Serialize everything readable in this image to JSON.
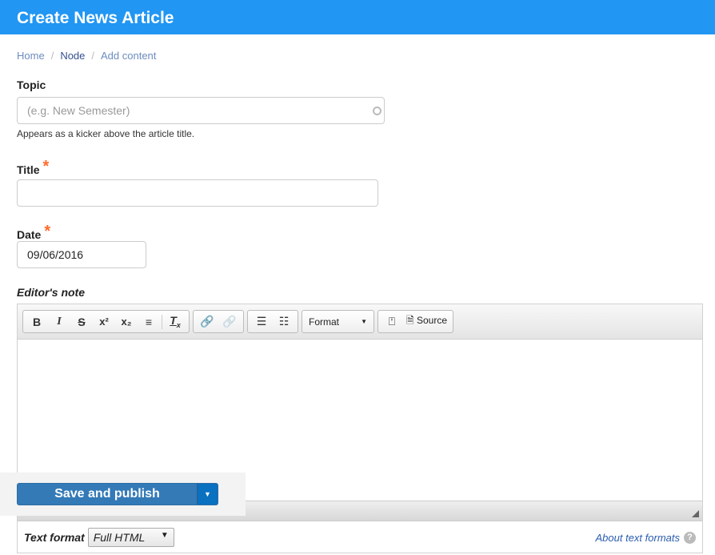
{
  "header": {
    "title": "Create News Article"
  },
  "breadcrumb": [
    "Home",
    "Node",
    "Add content"
  ],
  "fields": {
    "topic": {
      "label": "Topic",
      "placeholder": "(e.g. New Semester)",
      "help": "Appears as a kicker above the article title."
    },
    "title": {
      "label": "Title",
      "required": "*",
      "value": ""
    },
    "date": {
      "label": "Date",
      "required": "*",
      "value": "09/06/2016"
    },
    "editors_note": {
      "label": "Editor's note"
    }
  },
  "toolbar": {
    "bold": "B",
    "italic": "I",
    "strike": "S",
    "superscript": "x²",
    "subscript": "x₂",
    "format": "Format",
    "source": "Source"
  },
  "text_format": {
    "label": "Text format",
    "value": "Full HTML",
    "about": "About text formats",
    "help": "?"
  },
  "actions": {
    "save": "Save and publish"
  },
  "colors": {
    "header": "#2196f3",
    "primary": "#337ab7",
    "required": "#ff6a2b"
  }
}
